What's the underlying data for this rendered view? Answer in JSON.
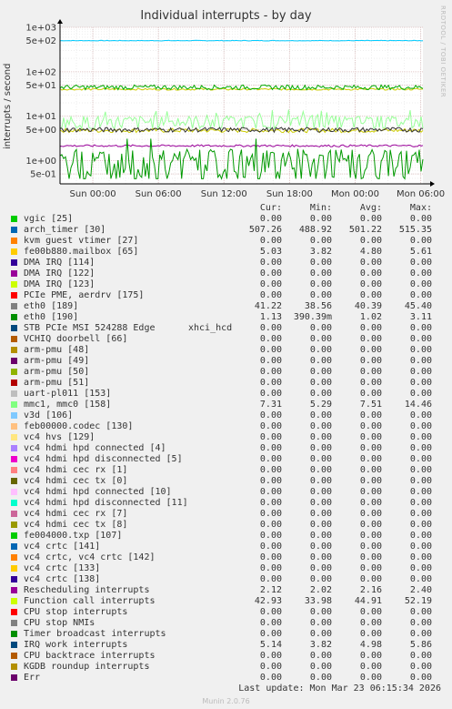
{
  "chart_data": {
    "type": "line",
    "title": "Individual interrupts - by day",
    "ylabel": "interrupts / second",
    "credit": "RRDTOOL / TOBI OETIKER",
    "y_scale": "log",
    "y_tick_labels": [
      "5e-01",
      "1e+00",
      "5e+00",
      "1e+01",
      "5e+01",
      "1e+02",
      "5e+02",
      "1e+03"
    ],
    "y_tick_values": [
      0.5,
      1,
      5,
      10,
      50,
      100,
      500,
      1000
    ],
    "x_tick_labels": [
      "Sun 00:00",
      "Sun 06:00",
      "Sun 12:00",
      "Sun 18:00",
      "Mon 00:00",
      "Mon 06:00"
    ],
    "x_tick_hours": [
      0,
      6,
      12,
      18,
      24,
      30
    ],
    "x_range_hours": [
      -3,
      30.2
    ],
    "ylim": [
      0.3,
      1000
    ],
    "grid": true,
    "series": [
      {
        "name": "arch_timer [30]",
        "color": "#00ccff",
        "value": 501.22,
        "min": 488.92,
        "max": 515.35
      },
      {
        "name": "fe00b880.mailbox [65]",
        "color": "#cccc00",
        "value": 4.8,
        "min": 3.82,
        "max": 5.61
      },
      {
        "name": "eth0 [189]",
        "color": "#cccc00",
        "value": 40.39,
        "min": 38.56,
        "max": 45.4
      },
      {
        "name": "mmc1, mmc0 [158]",
        "color": "#99ff99",
        "value": 7.51,
        "min": 5.29,
        "max": 14.46
      },
      {
        "name": "Function call interrupts",
        "color": "#00aa00",
        "value": 44.91,
        "min": 33.98,
        "max": 52.19
      },
      {
        "name": "Rescheduling interrupts",
        "color": "#990099",
        "value": 2.16,
        "min": 2.02,
        "max": 2.4
      },
      {
        "name": "IRQ work interrupts",
        "color": "#333333",
        "value": 4.98,
        "min": 3.82,
        "max": 5.86
      },
      {
        "name": "eth0 [190]",
        "color": "#009900",
        "value": 1.02,
        "min": 0.39,
        "max": 3.11
      }
    ]
  },
  "legend": {
    "headers": {
      "cur": "Cur:",
      "min": "Min:",
      "avg": "Avg:",
      "max": "Max:"
    },
    "rows": [
      {
        "name": "vgic [25]",
        "color": "#00cc00",
        "cur": "0.00",
        "min": "0.00",
        "avg": "0.00",
        "max": "0.00"
      },
      {
        "name": "arch_timer [30]",
        "color": "#0066b3",
        "cur": "507.26",
        "min": "488.92",
        "avg": "501.22",
        "max": "515.35"
      },
      {
        "name": "kvm guest vtimer [27]",
        "color": "#ff8000",
        "cur": "0.00",
        "min": "0.00",
        "avg": "0.00",
        "max": "0.00"
      },
      {
        "name": "fe00b880.mailbox [65]",
        "color": "#ffcc00",
        "cur": "5.03",
        "min": "3.82",
        "avg": "4.80",
        "max": "5.61"
      },
      {
        "name": "DMA IRQ [114]",
        "color": "#330099",
        "cur": "0.00",
        "min": "0.00",
        "avg": "0.00",
        "max": "0.00"
      },
      {
        "name": "DMA IRQ [122]",
        "color": "#990099",
        "cur": "0.00",
        "min": "0.00",
        "avg": "0.00",
        "max": "0.00"
      },
      {
        "name": "DMA IRQ [123]",
        "color": "#ccff00",
        "cur": "0.00",
        "min": "0.00",
        "avg": "0.00",
        "max": "0.00"
      },
      {
        "name": "PCIe PME, aerdrv [175]",
        "color": "#ff0000",
        "cur": "0.00",
        "min": "0.00",
        "avg": "0.00",
        "max": "0.00"
      },
      {
        "name": "eth0 [189]",
        "color": "#808080",
        "cur": "41.22",
        "min": "38.56",
        "avg": "40.39",
        "max": "45.40"
      },
      {
        "name": "eth0 [190]",
        "color": "#008f00",
        "cur": "1.13",
        "min": "390.39m",
        "avg": "1.02",
        "max": "3.11"
      },
      {
        "name": "STB PCIe MSI 524288 Edge",
        "extra": "xhci_hcd",
        "color": "#00487d",
        "cur": "0.00",
        "min": "0.00",
        "avg": "0.00",
        "max": "0.00"
      },
      {
        "name": "VCHIQ doorbell [66]",
        "color": "#b35a00",
        "cur": "0.00",
        "min": "0.00",
        "avg": "0.00",
        "max": "0.00"
      },
      {
        "name": "arm-pmu [48]",
        "color": "#b38f00",
        "cur": "0.00",
        "min": "0.00",
        "avg": "0.00",
        "max": "0.00"
      },
      {
        "name": "arm-pmu [49]",
        "color": "#6b006b",
        "cur": "0.00",
        "min": "0.00",
        "avg": "0.00",
        "max": "0.00"
      },
      {
        "name": "arm-pmu [50]",
        "color": "#8fb300",
        "cur": "0.00",
        "min": "0.00",
        "avg": "0.00",
        "max": "0.00"
      },
      {
        "name": "arm-pmu [51]",
        "color": "#b30000",
        "cur": "0.00",
        "min": "0.00",
        "avg": "0.00",
        "max": "0.00"
      },
      {
        "name": "uart-pl011 [153]",
        "color": "#bebebe",
        "cur": "0.00",
        "min": "0.00",
        "avg": "0.00",
        "max": "0.00"
      },
      {
        "name": "mmc1, mmc0 [158]",
        "color": "#80ff80",
        "cur": "7.31",
        "min": "5.29",
        "avg": "7.51",
        "max": "14.46"
      },
      {
        "name": "v3d [106]",
        "color": "#80c9ff",
        "cur": "0.00",
        "min": "0.00",
        "avg": "0.00",
        "max": "0.00"
      },
      {
        "name": "feb00000.codec [130]",
        "color": "#ffc080",
        "cur": "0.00",
        "min": "0.00",
        "avg": "0.00",
        "max": "0.00"
      },
      {
        "name": "vc4 hvs [129]",
        "color": "#ffe680",
        "cur": "0.00",
        "min": "0.00",
        "avg": "0.00",
        "max": "0.00"
      },
      {
        "name": "vc4 hdmi hpd connected [4]",
        "color": "#aa80ff",
        "cur": "0.00",
        "min": "0.00",
        "avg": "0.00",
        "max": "0.00"
      },
      {
        "name": "vc4 hdmi hpd disconnected [5]",
        "color": "#ee00cc",
        "cur": "0.00",
        "min": "0.00",
        "avg": "0.00",
        "max": "0.00"
      },
      {
        "name": "vc4 hdmi cec rx [1]",
        "color": "#ff8080",
        "cur": "0.00",
        "min": "0.00",
        "avg": "0.00",
        "max": "0.00"
      },
      {
        "name": "vc4 hdmi cec tx [0]",
        "color": "#666600",
        "cur": "0.00",
        "min": "0.00",
        "avg": "0.00",
        "max": "0.00"
      },
      {
        "name": "vc4 hdmi hpd connected [10]",
        "color": "#ffbfff",
        "cur": "0.00",
        "min": "0.00",
        "avg": "0.00",
        "max": "0.00"
      },
      {
        "name": "vc4 hdmi hpd disconnected [11]",
        "color": "#00ffcc",
        "cur": "0.00",
        "min": "0.00",
        "avg": "0.00",
        "max": "0.00"
      },
      {
        "name": "vc4 hdmi cec rx [7]",
        "color": "#cc6699",
        "cur": "0.00",
        "min": "0.00",
        "avg": "0.00",
        "max": "0.00"
      },
      {
        "name": "vc4 hdmi cec tx [8]",
        "color": "#999900",
        "cur": "0.00",
        "min": "0.00",
        "avg": "0.00",
        "max": "0.00"
      },
      {
        "name": "fe004000.txp [107]",
        "color": "#00cc00",
        "cur": "0.00",
        "min": "0.00",
        "avg": "0.00",
        "max": "0.00"
      },
      {
        "name": "vc4 crtc [141]",
        "color": "#0066b3",
        "cur": "0.00",
        "min": "0.00",
        "avg": "0.00",
        "max": "0.00"
      },
      {
        "name": "vc4 crtc, vc4 crtc [142]",
        "color": "#ff8000",
        "cur": "0.00",
        "min": "0.00",
        "avg": "0.00",
        "max": "0.00"
      },
      {
        "name": "vc4 crtc [133]",
        "color": "#ffcc00",
        "cur": "0.00",
        "min": "0.00",
        "avg": "0.00",
        "max": "0.00"
      },
      {
        "name": "vc4 crtc [138]",
        "color": "#330099",
        "cur": "0.00",
        "min": "0.00",
        "avg": "0.00",
        "max": "0.00"
      },
      {
        "name": "Rescheduling interrupts",
        "color": "#990099",
        "cur": "2.12",
        "min": "2.02",
        "avg": "2.16",
        "max": "2.40"
      },
      {
        "name": "Function call interrupts",
        "color": "#ccff00",
        "cur": "42.93",
        "min": "33.98",
        "avg": "44.91",
        "max": "52.19"
      },
      {
        "name": "CPU stop interrupts",
        "color": "#ff0000",
        "cur": "0.00",
        "min": "0.00",
        "avg": "0.00",
        "max": "0.00"
      },
      {
        "name": "CPU stop NMIs",
        "color": "#808080",
        "cur": "0.00",
        "min": "0.00",
        "avg": "0.00",
        "max": "0.00"
      },
      {
        "name": "Timer broadcast interrupts",
        "color": "#008f00",
        "cur": "0.00",
        "min": "0.00",
        "avg": "0.00",
        "max": "0.00"
      },
      {
        "name": "IRQ work interrupts",
        "color": "#00487d",
        "cur": "5.14",
        "min": "3.82",
        "avg": "4.98",
        "max": "5.86"
      },
      {
        "name": "CPU backtrace interrupts",
        "color": "#b35a00",
        "cur": "0.00",
        "min": "0.00",
        "avg": "0.00",
        "max": "0.00"
      },
      {
        "name": "KGDB roundup interrupts",
        "color": "#b38f00",
        "cur": "0.00",
        "min": "0.00",
        "avg": "0.00",
        "max": "0.00"
      },
      {
        "name": "Err",
        "color": "#6b006b",
        "cur": "0.00",
        "min": "0.00",
        "avg": "0.00",
        "max": "0.00"
      }
    ]
  },
  "footer": {
    "last_update": "Last update: Mon Mar 23 06:15:34 2026",
    "munin": "Munin 2.0.76"
  }
}
